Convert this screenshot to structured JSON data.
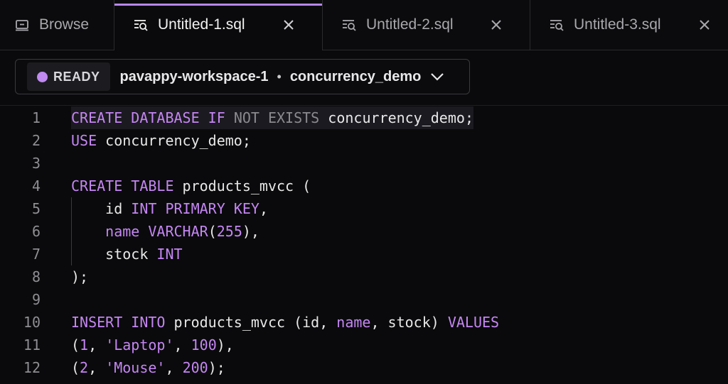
{
  "tabs": [
    {
      "label": "Browse",
      "icon": "monitor-icon",
      "active": false
    },
    {
      "label": "Untitled-1.sql",
      "icon": "query-file-icon",
      "active": true
    },
    {
      "label": "Untitled-2.sql",
      "icon": "query-file-icon",
      "active": false
    },
    {
      "label": "Untitled-3.sql",
      "icon": "query-file-icon",
      "active": false
    }
  ],
  "toolbar": {
    "status": "READY",
    "workspace": "pavappy-workspace-1",
    "separator": "•",
    "database": "concurrency_demo",
    "accent_color": "#b886f0"
  },
  "editor": {
    "line_numbers": [
      "1",
      "2",
      "3",
      "4",
      "5",
      "6",
      "7",
      "8",
      "9",
      "10",
      "11",
      "12"
    ],
    "lines": [
      [
        {
          "t": "CREATE",
          "c": "kw"
        },
        {
          "t": " "
        },
        {
          "t": "DATABASE",
          "c": "kw"
        },
        {
          "t": " "
        },
        {
          "t": "IF",
          "c": "kw"
        },
        {
          "t": " "
        },
        {
          "t": "NOT EXISTS",
          "c": "dim"
        },
        {
          "t": " concurrency_demo"
        },
        {
          "t": ";"
        }
      ],
      [
        {
          "t": "USE",
          "c": "kw"
        },
        {
          "t": " concurrency_demo;"
        }
      ],
      [],
      [
        {
          "t": "CREATE",
          "c": "kw"
        },
        {
          "t": " "
        },
        {
          "t": "TABLE",
          "c": "kw"
        },
        {
          "t": " products_mvcc ("
        }
      ],
      [
        {
          "t": "    id "
        },
        {
          "t": "INT",
          "c": "kw"
        },
        {
          "t": " "
        },
        {
          "t": "PRIMARY",
          "c": "kw"
        },
        {
          "t": " "
        },
        {
          "t": "KEY",
          "c": "kw"
        },
        {
          "t": ","
        }
      ],
      [
        {
          "t": "    "
        },
        {
          "t": "name",
          "c": "kw"
        },
        {
          "t": " "
        },
        {
          "t": "VARCHAR",
          "c": "kw"
        },
        {
          "t": "("
        },
        {
          "t": "255",
          "c": "num"
        },
        {
          "t": "),"
        }
      ],
      [
        {
          "t": "    stock "
        },
        {
          "t": "INT",
          "c": "kw"
        }
      ],
      [
        {
          "t": ");"
        }
      ],
      [],
      [
        {
          "t": "INSERT",
          "c": "kw"
        },
        {
          "t": " "
        },
        {
          "t": "INTO",
          "c": "kw"
        },
        {
          "t": " products_mvcc (id, "
        },
        {
          "t": "name",
          "c": "kw"
        },
        {
          "t": ", stock) "
        },
        {
          "t": "VALUES",
          "c": "kw"
        }
      ],
      [
        {
          "t": "("
        },
        {
          "t": "1",
          "c": "num"
        },
        {
          "t": ", "
        },
        {
          "t": "'Laptop'",
          "c": "str"
        },
        {
          "t": ", "
        },
        {
          "t": "100",
          "c": "num"
        },
        {
          "t": "),"
        }
      ],
      [
        {
          "t": "("
        },
        {
          "t": "2",
          "c": "num"
        },
        {
          "t": ", "
        },
        {
          "t": "'Mouse'",
          "c": "str"
        },
        {
          "t": ", "
        },
        {
          "t": "200",
          "c": "num"
        },
        {
          "t": ");"
        }
      ]
    ]
  }
}
